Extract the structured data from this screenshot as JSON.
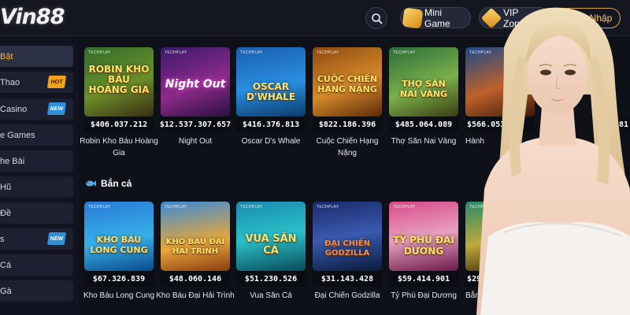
{
  "header": {
    "logo_letters": "Vin",
    "logo_number": "88",
    "mini_game_label": "Mini Game",
    "vip_label": "VIP Zone",
    "login_label": "Đăng Nhập"
  },
  "icons": {
    "search": "search-icon",
    "mini_game": "treasure-chest-icon",
    "vip": "diamond-icon",
    "fish": "fish-icon"
  },
  "sidebar": {
    "items": [
      {
        "label": "Bật",
        "badge": ""
      },
      {
        "label": "Thao",
        "badge": "HOT"
      },
      {
        "label": "Casino",
        "badge": "NEW"
      },
      {
        "label": "e Games",
        "badge": ""
      },
      {
        "label": "he Bài",
        "badge": ""
      },
      {
        "label": "Hũ",
        "badge": ""
      },
      {
        "label": "Đề",
        "badge": ""
      },
      {
        "label": "s",
        "badge": "NEW"
      },
      {
        "label": "Cá",
        "badge": ""
      },
      {
        "label": "Gà",
        "badge": ""
      }
    ]
  },
  "provider_label": "TECHPLAY",
  "top_games": [
    {
      "art": "ROBIN KHO BÁU HOÀNG GIA",
      "jackpot": "$406.037.212",
      "name": "Robin Kho Báu Hoàng Gia"
    },
    {
      "art": "Night Out",
      "jackpot": "$12.537.307.657",
      "name": "Night Out"
    },
    {
      "art": "OSCAR D'WHALE",
      "jackpot": "$416.376.813",
      "name": "Oscar D's Whale"
    },
    {
      "art": "CUỘC CHIẾN HẠNG NẶNG",
      "jackpot": "$822.186.396",
      "name": "Cuộc Chiến Hạng Nặng"
    },
    {
      "art": "THỢ SĂN NAI VÀNG",
      "jackpot": "$485.064.089",
      "name": "Thợ Săn Nai Vàng"
    },
    {
      "art": "",
      "jackpot": "$566.053.2",
      "name": "Hành"
    },
    {
      "art": "",
      "jackpot": "81",
      "name": ""
    }
  ],
  "section": {
    "title": "Bắn cá"
  },
  "fish_games": [
    {
      "art": "KHO BÁU LONG CUNG",
      "jackpot": "$67.326.839",
      "name": "Kho Báu Long Cung"
    },
    {
      "art": "KHO BÁU ĐẠI HẢI TRÌNH",
      "jackpot": "$48.060.146",
      "name": "Kho Báu Đại Hải Trình"
    },
    {
      "art": "VUA SĂN CÁ",
      "jackpot": "$51.230.526",
      "name": "Vua Săn Cá"
    },
    {
      "art": "ĐẠI CHIẾN GODZILLA",
      "jackpot": "$31.143.428",
      "name": "Đại Chiến Godzilla"
    },
    {
      "art": "TỶ PHÚ ĐẠI DƯƠNG",
      "jackpot": "$59.414.901",
      "name": "Tỷ Phú Đại Dương"
    },
    {
      "art": "",
      "jackpot": "$29.",
      "name": "Bắn C"
    }
  ],
  "colors": {
    "background": "#0f1118",
    "accent_gold": "#ffcc66",
    "hot_badge": "#f0a11d",
    "new_badge": "#2f8fd8"
  }
}
